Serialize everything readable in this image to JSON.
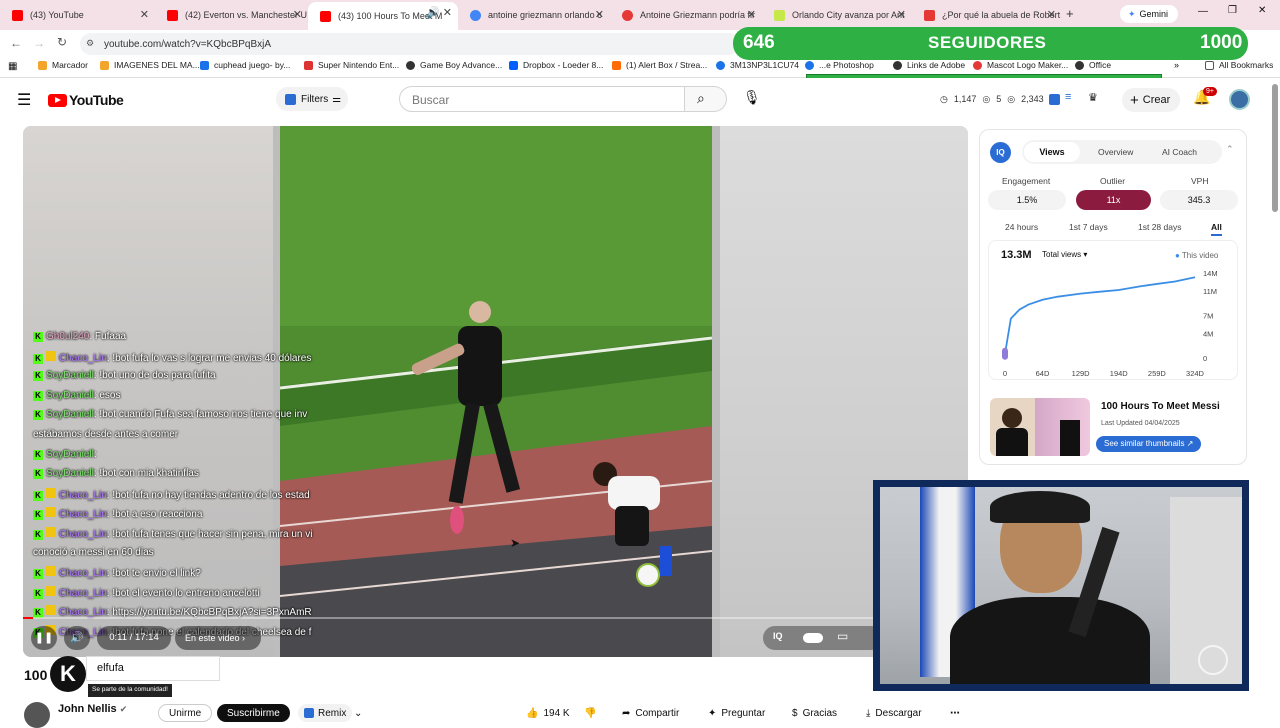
{
  "tabs": [
    {
      "title": "(43) YouTube",
      "color": "#ff0000"
    },
    {
      "title": "(42) Everton vs. Manchester U",
      "color": "#ff0000"
    },
    {
      "title": "(43) 100 Hours To Meet M",
      "color": "#ff0000"
    },
    {
      "title": "antoine griezmann orlando c",
      "color": "#4285f4"
    },
    {
      "title": "Antoine Griezmann podría fir",
      "color": "#e53935"
    },
    {
      "title": "Orlando City avanza por Ant",
      "color": "#c6e84a"
    },
    {
      "title": "¿Por qué la abuela de Robert",
      "color": "#e53935"
    }
  ],
  "gemini_label": "Gemini",
  "url": "youtube.com/watch?v=KQbcBPqBxjA",
  "bookmarks": [
    "Marcador",
    "IMAGENES DEL MA...",
    "cuphead juego- by...",
    "Super Nintendo Ent...",
    "Game Boy Advance...",
    "Dropbox - Loeder 8...",
    "(1) Alert Box / Strea...",
    "3M13NP3L1CU74",
    "...e Photoshop",
    "Links de Adobe",
    "Mascot Logo Maker...",
    "Office",
    "All Bookmarks"
  ],
  "banner": {
    "left": "646",
    "mid": "SEGUIDORES",
    "right": "1000"
  },
  "yt": {
    "logo": "YouTube",
    "filters": "Filters",
    "search_placeholder": "Buscar",
    "stats": [
      "1,147",
      "5",
      "2,343"
    ],
    "create": "Crear",
    "notif": "9+"
  },
  "chat": [
    {
      "user": "Gh0ul240",
      "cls": "u-g",
      "msg": ": Fufaaa",
      "badge": false
    },
    {
      "user": "Chaco_Lin",
      "cls": "u-p",
      "msg": ": !bot fufa lo vas s lograr me envias 40 dólares",
      "badge": true
    },
    {
      "user": "SoyDaniell",
      "cls": "u-s",
      "msg": ": !bot uno de dos para fufita",
      "badge": false
    },
    {
      "user": "SoyDaniell",
      "cls": "u-s",
      "msg": ": esos",
      "badge": false
    },
    {
      "user": "SoyDaniell",
      "cls": "u-s",
      "msg": ": !bot cuando Fufa sea famoso nos tiene que inv",
      "badge": false
    },
    {
      "user": "",
      "cls": "",
      "msg": "estábamos desde antes a comer",
      "badge": false
    },
    {
      "user": "SoyDaniell",
      "cls": "u-s",
      "msg": ":",
      "badge": false
    },
    {
      "user": "SoyDaniell",
      "cls": "u-s",
      "msg": ": !bot con mia khatinflas",
      "badge": false
    },
    {
      "user": "Chaco_Lin",
      "cls": "u-p",
      "msg": ": !bot fufa no hay tiendas adentro de los estad",
      "badge": true
    },
    {
      "user": "Chaco_Lin",
      "cls": "u-p",
      "msg": ": !bot a eso reacciona",
      "badge": true
    },
    {
      "user": "Chaco_Lin",
      "cls": "u-p",
      "msg": ": !bot fufa tenes que hacer sin pena, mira un vi",
      "badge": true
    },
    {
      "user": "",
      "cls": "",
      "msg": "conoció a messi en 60 dias",
      "badge": false
    },
    {
      "user": "Chaco_Lin",
      "cls": "u-p",
      "msg": ": !bot te envio el link?",
      "badge": true
    },
    {
      "user": "Chaco_Lin",
      "cls": "u-p",
      "msg": ": !bot el evento lo entreno ancelotti",
      "badge": true
    },
    {
      "user": "Chaco_Lin",
      "cls": "u-p",
      "msg": ": https://youtu.be/KQbcBPqBxjA?si=3PxnAmR",
      "badge": true
    },
    {
      "user": "Chaco_Lin",
      "cls": "u-p",
      "msg": ": !bot fufa pone el calendario del cheelsea de f",
      "badge": true
    }
  ],
  "player": {
    "time": "0:11 / 17:14",
    "chapter": "En este video",
    "progress": 0.011
  },
  "vidiq": {
    "tabs": [
      "Views",
      "Overview",
      "AI Coach"
    ],
    "metrics": [
      {
        "label": "Engagement",
        "value": "1.5%"
      },
      {
        "label": "Outlier",
        "value": "11x"
      },
      {
        "label": "VPH",
        "value": "345.3"
      }
    ],
    "ranges": [
      "24 hours",
      "1st 7 days",
      "1st 28 days",
      "All"
    ],
    "total": "13.3M",
    "select": "Total views",
    "legend": "This video",
    "thumb_title": "100 Hours To Meet Messi",
    "updated": "Last Updated 04/04/2025",
    "similar": "See similar thumbnails"
  },
  "chart_data": {
    "type": "line",
    "x": [
      0,
      10,
      25,
      40,
      64,
      90,
      129,
      160,
      194,
      230,
      259,
      290,
      324
    ],
    "series": [
      {
        "name": "This video",
        "values": [
          0.7,
          6.5,
          8.0,
          8.8,
          9.6,
          10.1,
          10.6,
          10.9,
          11.2,
          11.8,
          12.2,
          12.6,
          13.3
        ]
      }
    ],
    "xticks": [
      "0",
      "64D",
      "129D",
      "194D",
      "259D",
      "324D"
    ],
    "yticks": [
      "14M",
      "11M",
      "7M",
      "4M",
      "0"
    ],
    "ylim": [
      0,
      14
    ],
    "xlim": [
      0,
      324
    ],
    "color": "#3b8ee6"
  },
  "kick": {
    "name": "elfufa",
    "sub": "Se parte de la comunidad!"
  },
  "title_partial": "100",
  "channel": {
    "name": "John Nellis"
  },
  "actions": {
    "join": "Unirme",
    "subscribe": "Suscribirme",
    "remix": "Remix",
    "likes": "194 K",
    "share": "Compartir",
    "ask": "Preguntar",
    "thanks": "Gracias",
    "download": "Descargar"
  }
}
